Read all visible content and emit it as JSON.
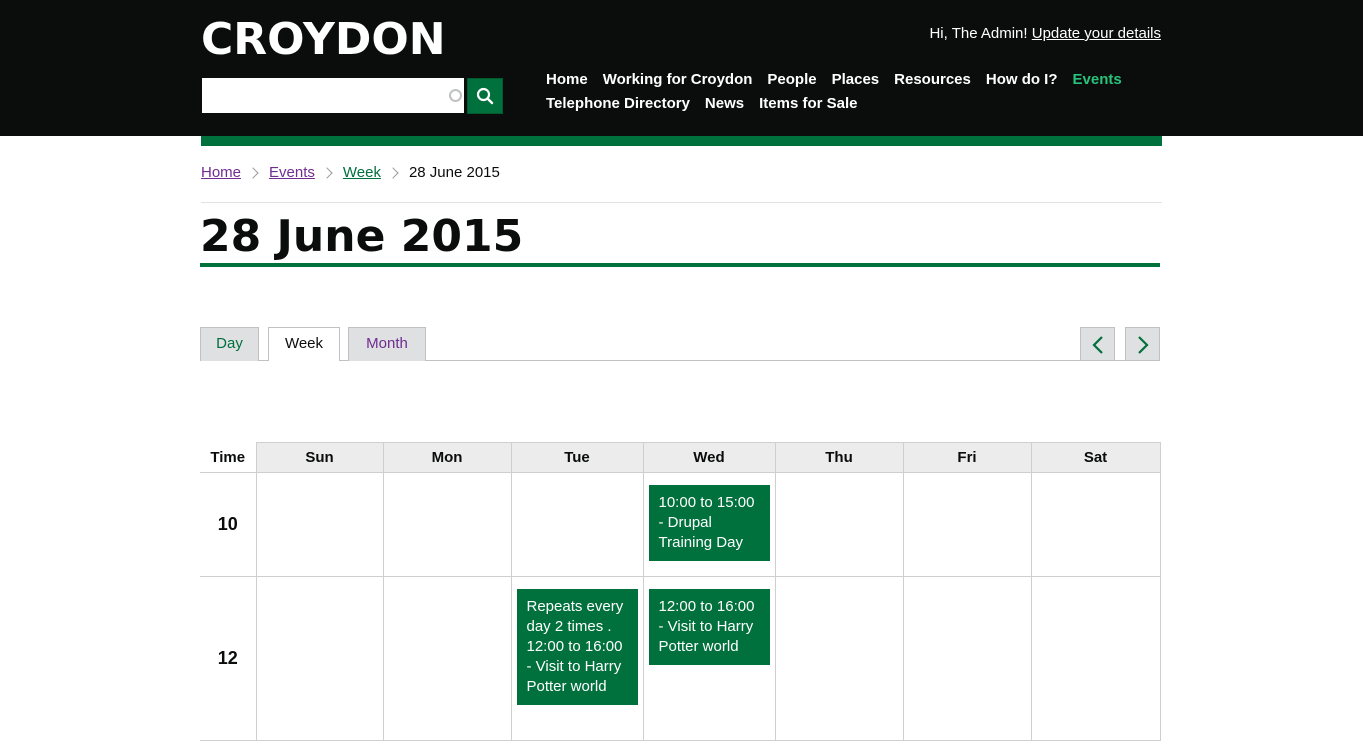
{
  "header": {
    "logo": "CROYDON",
    "search": {
      "value": "",
      "placeholder": ""
    },
    "greeting": "Hi, The Admin!",
    "update_link": "Update your details",
    "nav": [
      {
        "label": "Home",
        "active": false
      },
      {
        "label": "Working for Croydon",
        "active": false
      },
      {
        "label": "People",
        "active": false
      },
      {
        "label": "Places",
        "active": false
      },
      {
        "label": "Resources",
        "active": false
      },
      {
        "label": "How do I?",
        "active": false
      },
      {
        "label": "Events",
        "active": true
      },
      {
        "label": "Telephone Directory",
        "active": false
      },
      {
        "label": "News",
        "active": false
      },
      {
        "label": "Items for Sale",
        "active": false
      }
    ]
  },
  "breadcrumb": {
    "items": [
      "Home",
      "Events",
      "Week"
    ],
    "current": "28 June 2015"
  },
  "page_title": "28 June 2015",
  "tabs": {
    "day": "Day",
    "week": "Week",
    "month": "Month",
    "selected": "Week"
  },
  "calendar": {
    "time_header": "Time",
    "days": [
      "Sun",
      "Mon",
      "Tue",
      "Wed",
      "Thu",
      "Fri",
      "Sat"
    ],
    "rows": [
      {
        "time": "10",
        "events": {
          "Wed": "10:00 to 15:00 - Drupal Training Day"
        }
      },
      {
        "time": "12",
        "events": {
          "Tue": "Repeats every day 2 times . 12:00 to 16:00 - Visit to Harry Potter world",
          "Wed": "12:00 to 16:00 - Visit to Harry Potter world"
        }
      }
    ]
  },
  "colors": {
    "header_bg": "#0b0c0c",
    "brand_green": "#00703c",
    "active_nav": "#28c27a",
    "visited_link": "#6f2c91"
  }
}
